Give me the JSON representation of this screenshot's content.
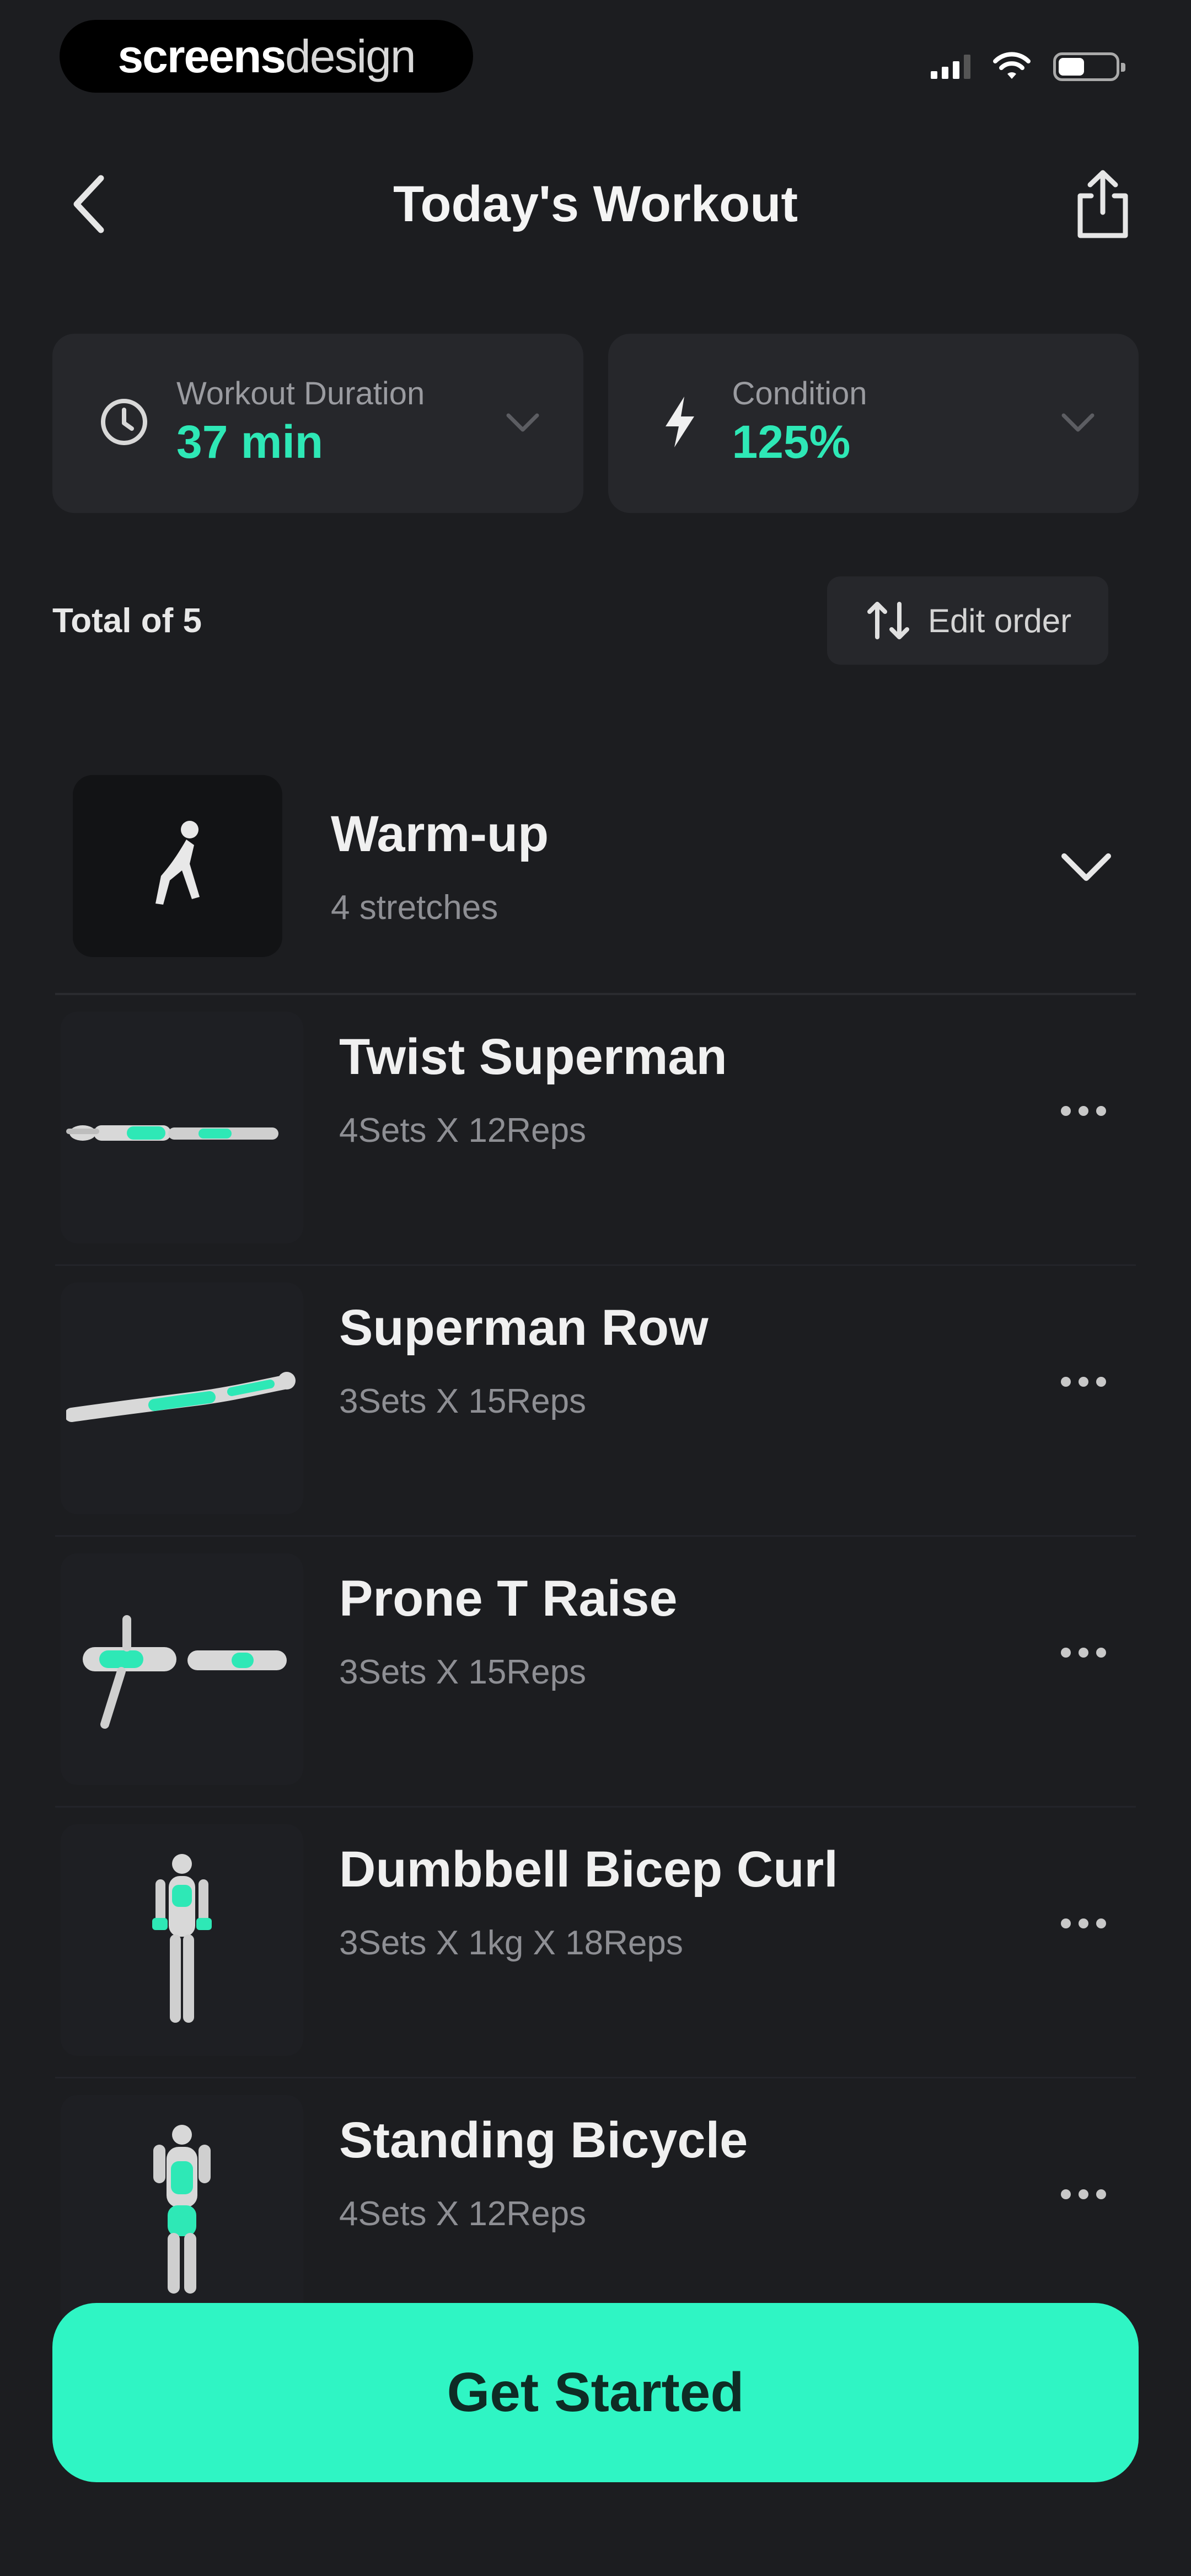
{
  "status_bar": {
    "brand_bold": "screens",
    "brand_thin": "design"
  },
  "header": {
    "title": "Today's Workout",
    "back_icon": "chevron-left-icon",
    "share_icon": "share-icon"
  },
  "stats": [
    {
      "label": "Workout Duration",
      "value": "37 min",
      "icon": "clock-icon"
    },
    {
      "label": "Condition",
      "value": "125%",
      "icon": "lightning-icon"
    }
  ],
  "list_header": {
    "total": "Total of 5",
    "edit_order": "Edit order",
    "edit_icon": "sort-arrows-icon"
  },
  "warmup": {
    "name": "Warm-up",
    "detail": "4 stretches"
  },
  "exercises": [
    {
      "name": "Twist Superman",
      "detail": "4Sets X 12Reps"
    },
    {
      "name": "Superman Row",
      "detail": "3Sets X 15Reps"
    },
    {
      "name": "Prone T Raise",
      "detail": "3Sets X 15Reps"
    },
    {
      "name": "Dumbbell Bicep Curl",
      "detail": "3Sets X 1kg X 18Reps"
    },
    {
      "name": "Standing Bicycle",
      "detail": "4Sets X 12Reps"
    }
  ],
  "cta": {
    "label": "Get Started"
  },
  "colors": {
    "accent": "#2ff5c4",
    "value_green": "#2ee8b6",
    "background": "#1c1d20",
    "card": "#26272b"
  }
}
